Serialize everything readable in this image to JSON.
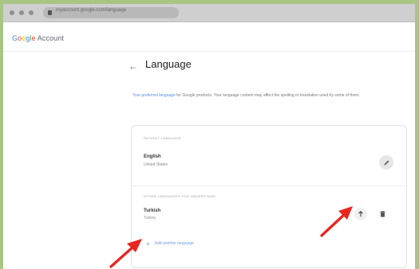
{
  "browser": {
    "url": "myaccount.google.com/language"
  },
  "header": {
    "logo_parts": [
      "G",
      "o",
      "o",
      "g",
      "l",
      "e"
    ],
    "logo_suffix": " Account"
  },
  "page": {
    "title": "Language",
    "description_link": "Your preferred language",
    "description_rest": " for Google products. Your language content may affect the spelling or translation used by some of them."
  },
  "default_language": {
    "section_label": "Default language",
    "name": "English",
    "region": "United States"
  },
  "other_languages": {
    "section_label": "Other languages you understand",
    "items": [
      {
        "name": "Turkish",
        "region": "Turkey"
      }
    ],
    "add_label": "Add another language"
  },
  "colors": {
    "annotation_arrow": "#e8261f",
    "link": "#5a8ee0"
  },
  "icons": {
    "back": "arrow-left-icon",
    "edit": "pencil-icon",
    "move_up": "arrow-up-icon",
    "delete": "trash-icon",
    "add": "plus-icon"
  }
}
